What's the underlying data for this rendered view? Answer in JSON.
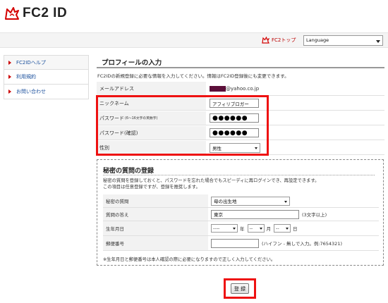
{
  "app": {
    "logo_text": "FC2 ID"
  },
  "topbar": {
    "fc2top_label": "FC2トップ",
    "language_label": "Language"
  },
  "sidebar": {
    "items": [
      {
        "label": "FC2IDヘルプ"
      },
      {
        "label": "利用規約"
      },
      {
        "label": "お問い合わせ"
      }
    ]
  },
  "profile": {
    "title": "プロフィールの入力",
    "intro": "FC2IDの新規登録に必要な情報を入力してください。情報はFC2ID登録後にも変更できます。",
    "email_label": "メールアドレス",
    "email_suffix": "@yahoo.co.jp",
    "nickname_label": "ニックネーム",
    "nickname_value": "アフィリブロガー",
    "password_label": "パスワード",
    "password_note": "(6～16文字の英数字)",
    "password_value": "●●●●●●",
    "password_confirm_label": "パスワード(確認)",
    "password_confirm_value": "●●●●●●",
    "gender_label": "性別",
    "gender_value": "男性"
  },
  "secret": {
    "title": "秘密の質問の登録",
    "desc_line1": "秘密の質問を登録しておくと、パスワードを忘れた場合でもスピーディに再ログインでき、再設定できます。",
    "desc_line2": "この項目は任意登録ですが、登録を推奨します。",
    "question_label": "秘密の質問",
    "question_value": "母の出生地",
    "answer_label": "質問の答え",
    "answer_value": "東京",
    "answer_hint": "(3文字以上)",
    "birth_label": "生年月日",
    "birth_year": "----",
    "birth_year_unit": "年",
    "birth_month": "--",
    "birth_month_unit": "月",
    "birth_day": "--",
    "birth_day_unit": "日",
    "zip_label": "郵便番号",
    "zip_value": "",
    "zip_hint": "(ハイフン - 無しで入力。例:7654321)",
    "note": "※生年月日と郵便番号は本人確認の際に必要になりますので正しく入力してください。"
  },
  "submit": {
    "label": "登 録"
  },
  "colors": {
    "highlight": "#e11111",
    "link": "#1a4f9c",
    "accent_red": "#cc0000"
  }
}
